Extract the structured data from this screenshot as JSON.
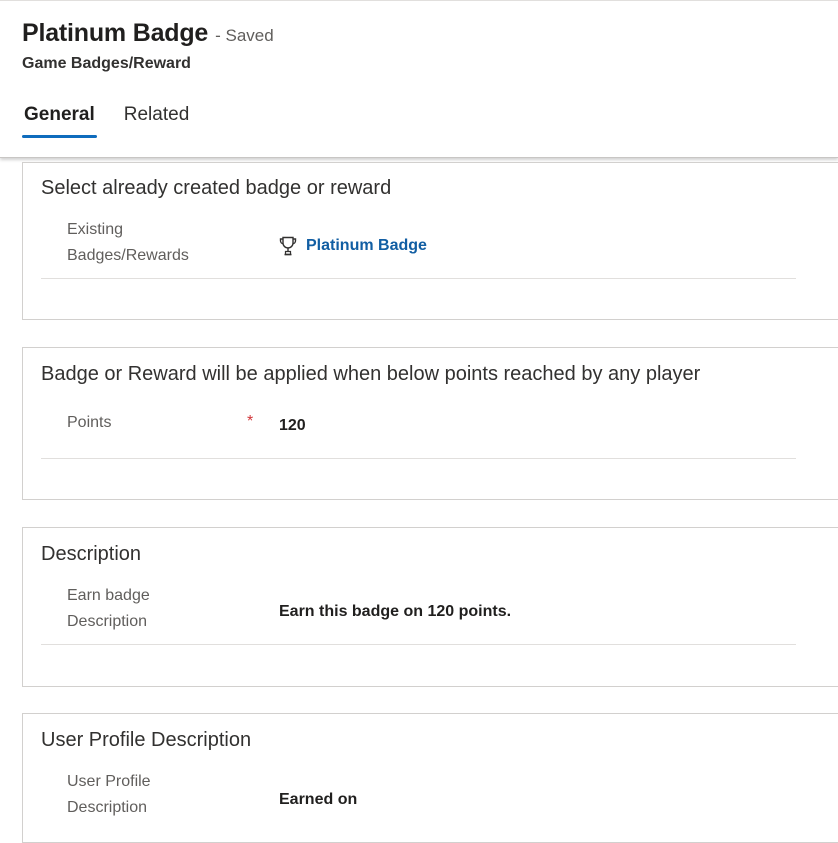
{
  "header": {
    "record_title": "Platinum Badge",
    "save_status": "- Saved",
    "entity_name": "Game Badges/Reward"
  },
  "tabs": [
    {
      "label": "General",
      "active": true
    },
    {
      "label": "Related",
      "active": false
    }
  ],
  "sections": {
    "existing": {
      "title": "Select already created badge or reward",
      "label_line1": "Existing",
      "label_line2": "Badges/Rewards",
      "value": "Platinum Badge",
      "icon": "trophy-icon"
    },
    "points": {
      "title": "Badge or Reward will be applied when below points reached by any player",
      "label": "Points",
      "required_mark": "*",
      "value": "120"
    },
    "description": {
      "title": "Description",
      "label_line1": "Earn badge",
      "label_line2": "Description",
      "value": "Earn this badge on 120 points."
    },
    "user_profile": {
      "title": "User Profile Description",
      "label_line1": "User Profile",
      "label_line2": "Description",
      "value": "Earned on"
    }
  },
  "colors": {
    "accent": "#0f6cbd",
    "link": "#115ea3",
    "required": "#d13438"
  }
}
